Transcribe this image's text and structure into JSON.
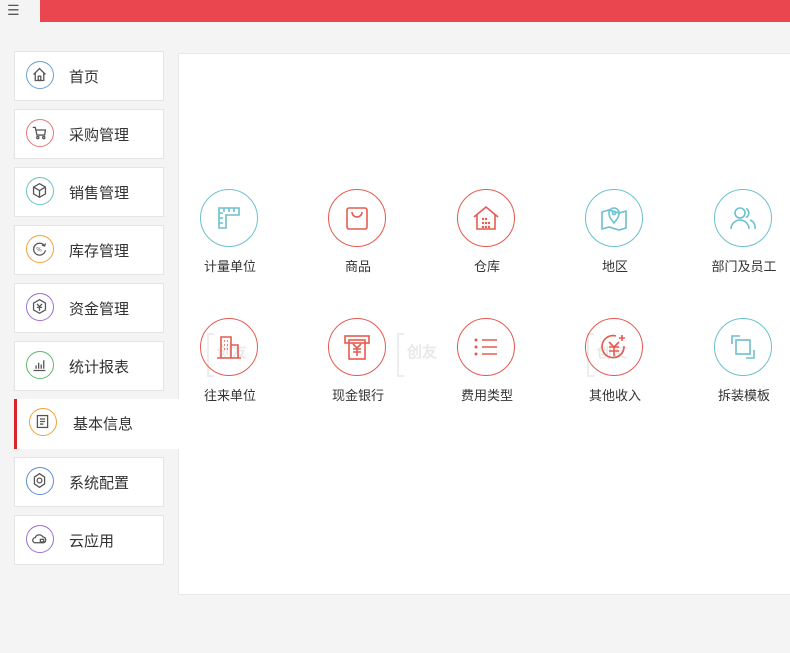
{
  "topbar": {
    "menu_icon": "hamburger-icon",
    "color": "#e9464f"
  },
  "sidebar": {
    "active_color": "#d9232d",
    "items": [
      {
        "label": "首页",
        "icon": "home-icon",
        "color": "#6a9fd4"
      },
      {
        "label": "采购管理",
        "icon": "cart-icon",
        "color": "#e6787a"
      },
      {
        "label": "销售管理",
        "icon": "box-icon",
        "color": "#6cc0cf"
      },
      {
        "label": "库存管理",
        "icon": "inventory-icon",
        "color": "#f0a13c"
      },
      {
        "label": "资金管理",
        "icon": "funds-icon",
        "color": "#9b6fd0"
      },
      {
        "label": "统计报表",
        "icon": "chart-icon",
        "color": "#5cb86b"
      },
      {
        "label": "基本信息",
        "icon": "document-icon",
        "color": "#f0a13c",
        "active": true
      },
      {
        "label": "系统配置",
        "icon": "settings-icon",
        "color": "#5a8fd8"
      },
      {
        "label": "云应用",
        "icon": "cloud-icon",
        "color": "#9b6fd0"
      }
    ]
  },
  "main": {
    "watermark_text": "创友",
    "items": [
      {
        "label": "计量单位",
        "icon": "ruler-icon",
        "color": "#6cc0cf"
      },
      {
        "label": "商品",
        "icon": "bag-icon",
        "color": "#e45b50"
      },
      {
        "label": "仓库",
        "icon": "warehouse-icon",
        "color": "#e45b50"
      },
      {
        "label": "地区",
        "icon": "map-pin-icon",
        "color": "#6cc0cf"
      },
      {
        "label": "部门及员工",
        "icon": "users-icon",
        "color": "#6cc0cf"
      },
      {
        "label": "往来单位",
        "icon": "building-icon",
        "color": "#e45b50"
      },
      {
        "label": "现金银行",
        "icon": "cash-icon",
        "color": "#e45b50"
      },
      {
        "label": "费用类型",
        "icon": "list-icon",
        "color": "#e45b50"
      },
      {
        "label": "其他收入",
        "icon": "income-icon",
        "color": "#e45b50"
      },
      {
        "label": "拆装模板",
        "icon": "template-icon",
        "color": "#6cc0cf"
      }
    ]
  }
}
